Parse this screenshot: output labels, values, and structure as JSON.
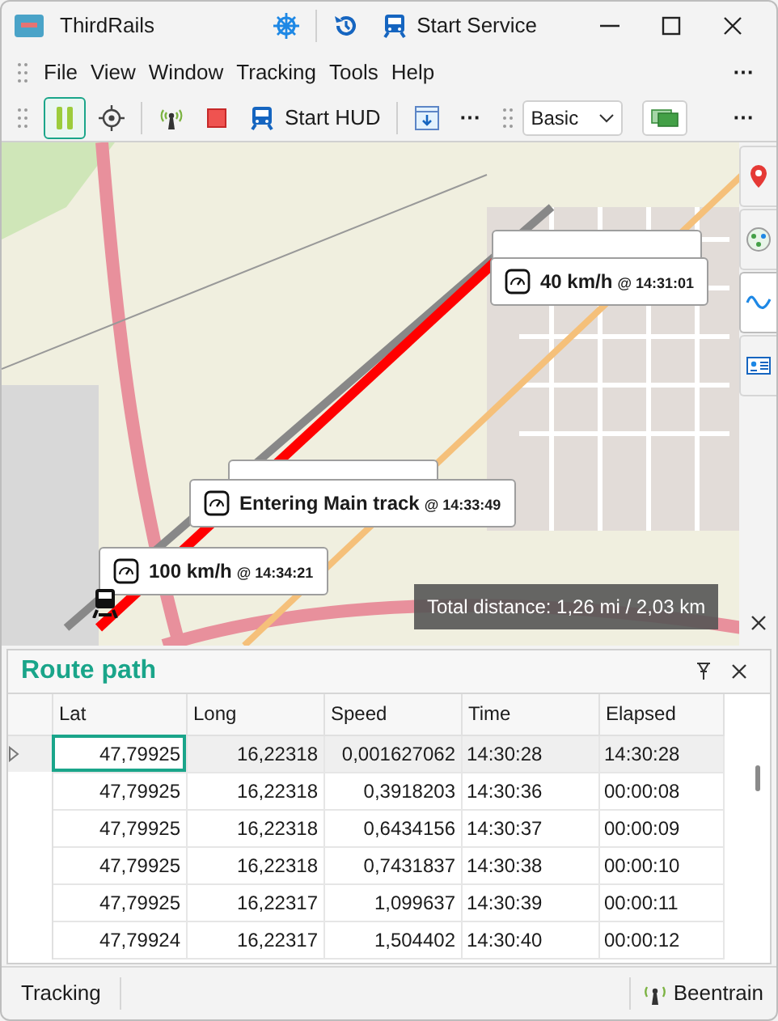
{
  "window": {
    "title": "ThirdRails",
    "actions": [
      {
        "kind": "helm"
      },
      {
        "kind": "history"
      },
      {
        "kind": "service",
        "label": "Start Service"
      }
    ]
  },
  "menu": {
    "items": [
      "File",
      "View",
      "Window",
      "Tracking",
      "Tools",
      "Help"
    ],
    "overflow": "⋯"
  },
  "toolbar": {
    "items": [
      {
        "kind": "pause",
        "selected": true
      },
      {
        "kind": "locate"
      },
      {
        "kind": "sep"
      },
      {
        "kind": "signal"
      },
      {
        "kind": "stop"
      },
      {
        "kind": "hud",
        "label": "Start HUD"
      },
      {
        "kind": "sep"
      },
      {
        "kind": "download"
      },
      {
        "kind": "more",
        "label": "⋯"
      },
      {
        "kind": "grip"
      },
      {
        "kind": "select",
        "value": "Basic"
      },
      {
        "kind": "layers"
      }
    ],
    "overflow": "⋯"
  },
  "map": {
    "callouts": [
      {
        "hidden": true
      },
      {
        "text": "40 km/h",
        "time": "@ 14:31:01",
        "hidden": false
      },
      {
        "hidden": true
      },
      {
        "text": "Entering Main track",
        "time": "@ 14:33:49",
        "hidden": false
      },
      {
        "text": "100 km/h",
        "time": "@ 14:34:21",
        "hidden": false
      }
    ],
    "total_distance": "Total distance: 1,26 mi / 2,03 km",
    "side_tabs": [
      {
        "kind": "pin",
        "selected": false
      },
      {
        "kind": "network",
        "selected": false
      },
      {
        "kind": "route",
        "selected": true
      },
      {
        "kind": "card",
        "selected": false
      }
    ]
  },
  "panel": {
    "title": "Route path",
    "table": {
      "columns": [
        "Lat",
        "Long",
        "Speed",
        "Time",
        "Elapsed"
      ],
      "rows": [
        {
          "cells": [
            "47,79925",
            "16,22318",
            "0,001627062",
            "14:30:28",
            "14:30:28"
          ],
          "selected": true
        },
        {
          "cells": [
            "47,79925",
            "16,22318",
            "0,3918203",
            "14:30:36",
            "00:00:08"
          ],
          "selected": false
        },
        {
          "cells": [
            "47,79925",
            "16,22318",
            "0,6434156",
            "14:30:37",
            "00:00:09"
          ],
          "selected": false
        },
        {
          "cells": [
            "47,79925",
            "16,22318",
            "0,7431837",
            "14:30:38",
            "00:00:10"
          ],
          "selected": false
        },
        {
          "cells": [
            "47,79925",
            "16,22317",
            "1,099637",
            "14:30:39",
            "00:00:11"
          ],
          "selected": false
        },
        {
          "cells": [
            "47,79924",
            "16,22317",
            "1,504402",
            "14:30:40",
            "00:00:12"
          ],
          "selected": false
        }
      ]
    }
  },
  "status_bar": {
    "left": "Tracking",
    "right": "Beentrain"
  }
}
